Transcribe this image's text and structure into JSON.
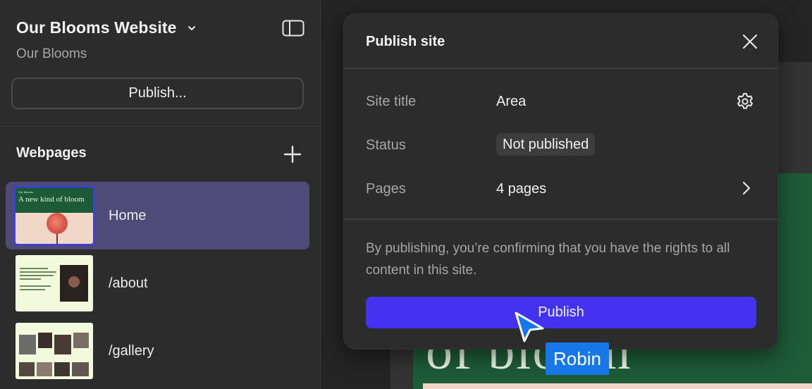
{
  "sidebar": {
    "site_title": "Our Blooms Website",
    "site_subtitle": "Our Blooms",
    "publish_button": "Publish...",
    "webpages_title": "Webpages",
    "pages": [
      {
        "label": "Home",
        "active": true,
        "thumb_heading": "Our Blooms",
        "thumb_title": "A new kind of bloom"
      },
      {
        "label": "/about",
        "active": false
      },
      {
        "label": "/gallery",
        "active": false
      }
    ]
  },
  "canvas": {
    "hero_fragment": "of bloom"
  },
  "modal": {
    "title": "Publish site",
    "rows": {
      "site_title_label": "Site title",
      "site_title_value": "Area",
      "status_label": "Status",
      "status_value": "Not published",
      "pages_label": "Pages",
      "pages_value": "4 pages"
    },
    "disclaimer": "By publishing, you’re confirming that you have the rights to all content in this site.",
    "publish_button": "Publish"
  },
  "cursor": {
    "name": "Robin",
    "color": "#1877e8"
  },
  "colors": {
    "accent": "#4332ef",
    "active_item": "#4f4a77",
    "canvas_green": "#1e5b37"
  },
  "icons": [
    "chevron-down-icon",
    "sidebar-toggle-icon",
    "plus-icon",
    "close-icon",
    "gear-icon",
    "chevron-right-icon",
    "cursor-pointer-icon"
  ]
}
